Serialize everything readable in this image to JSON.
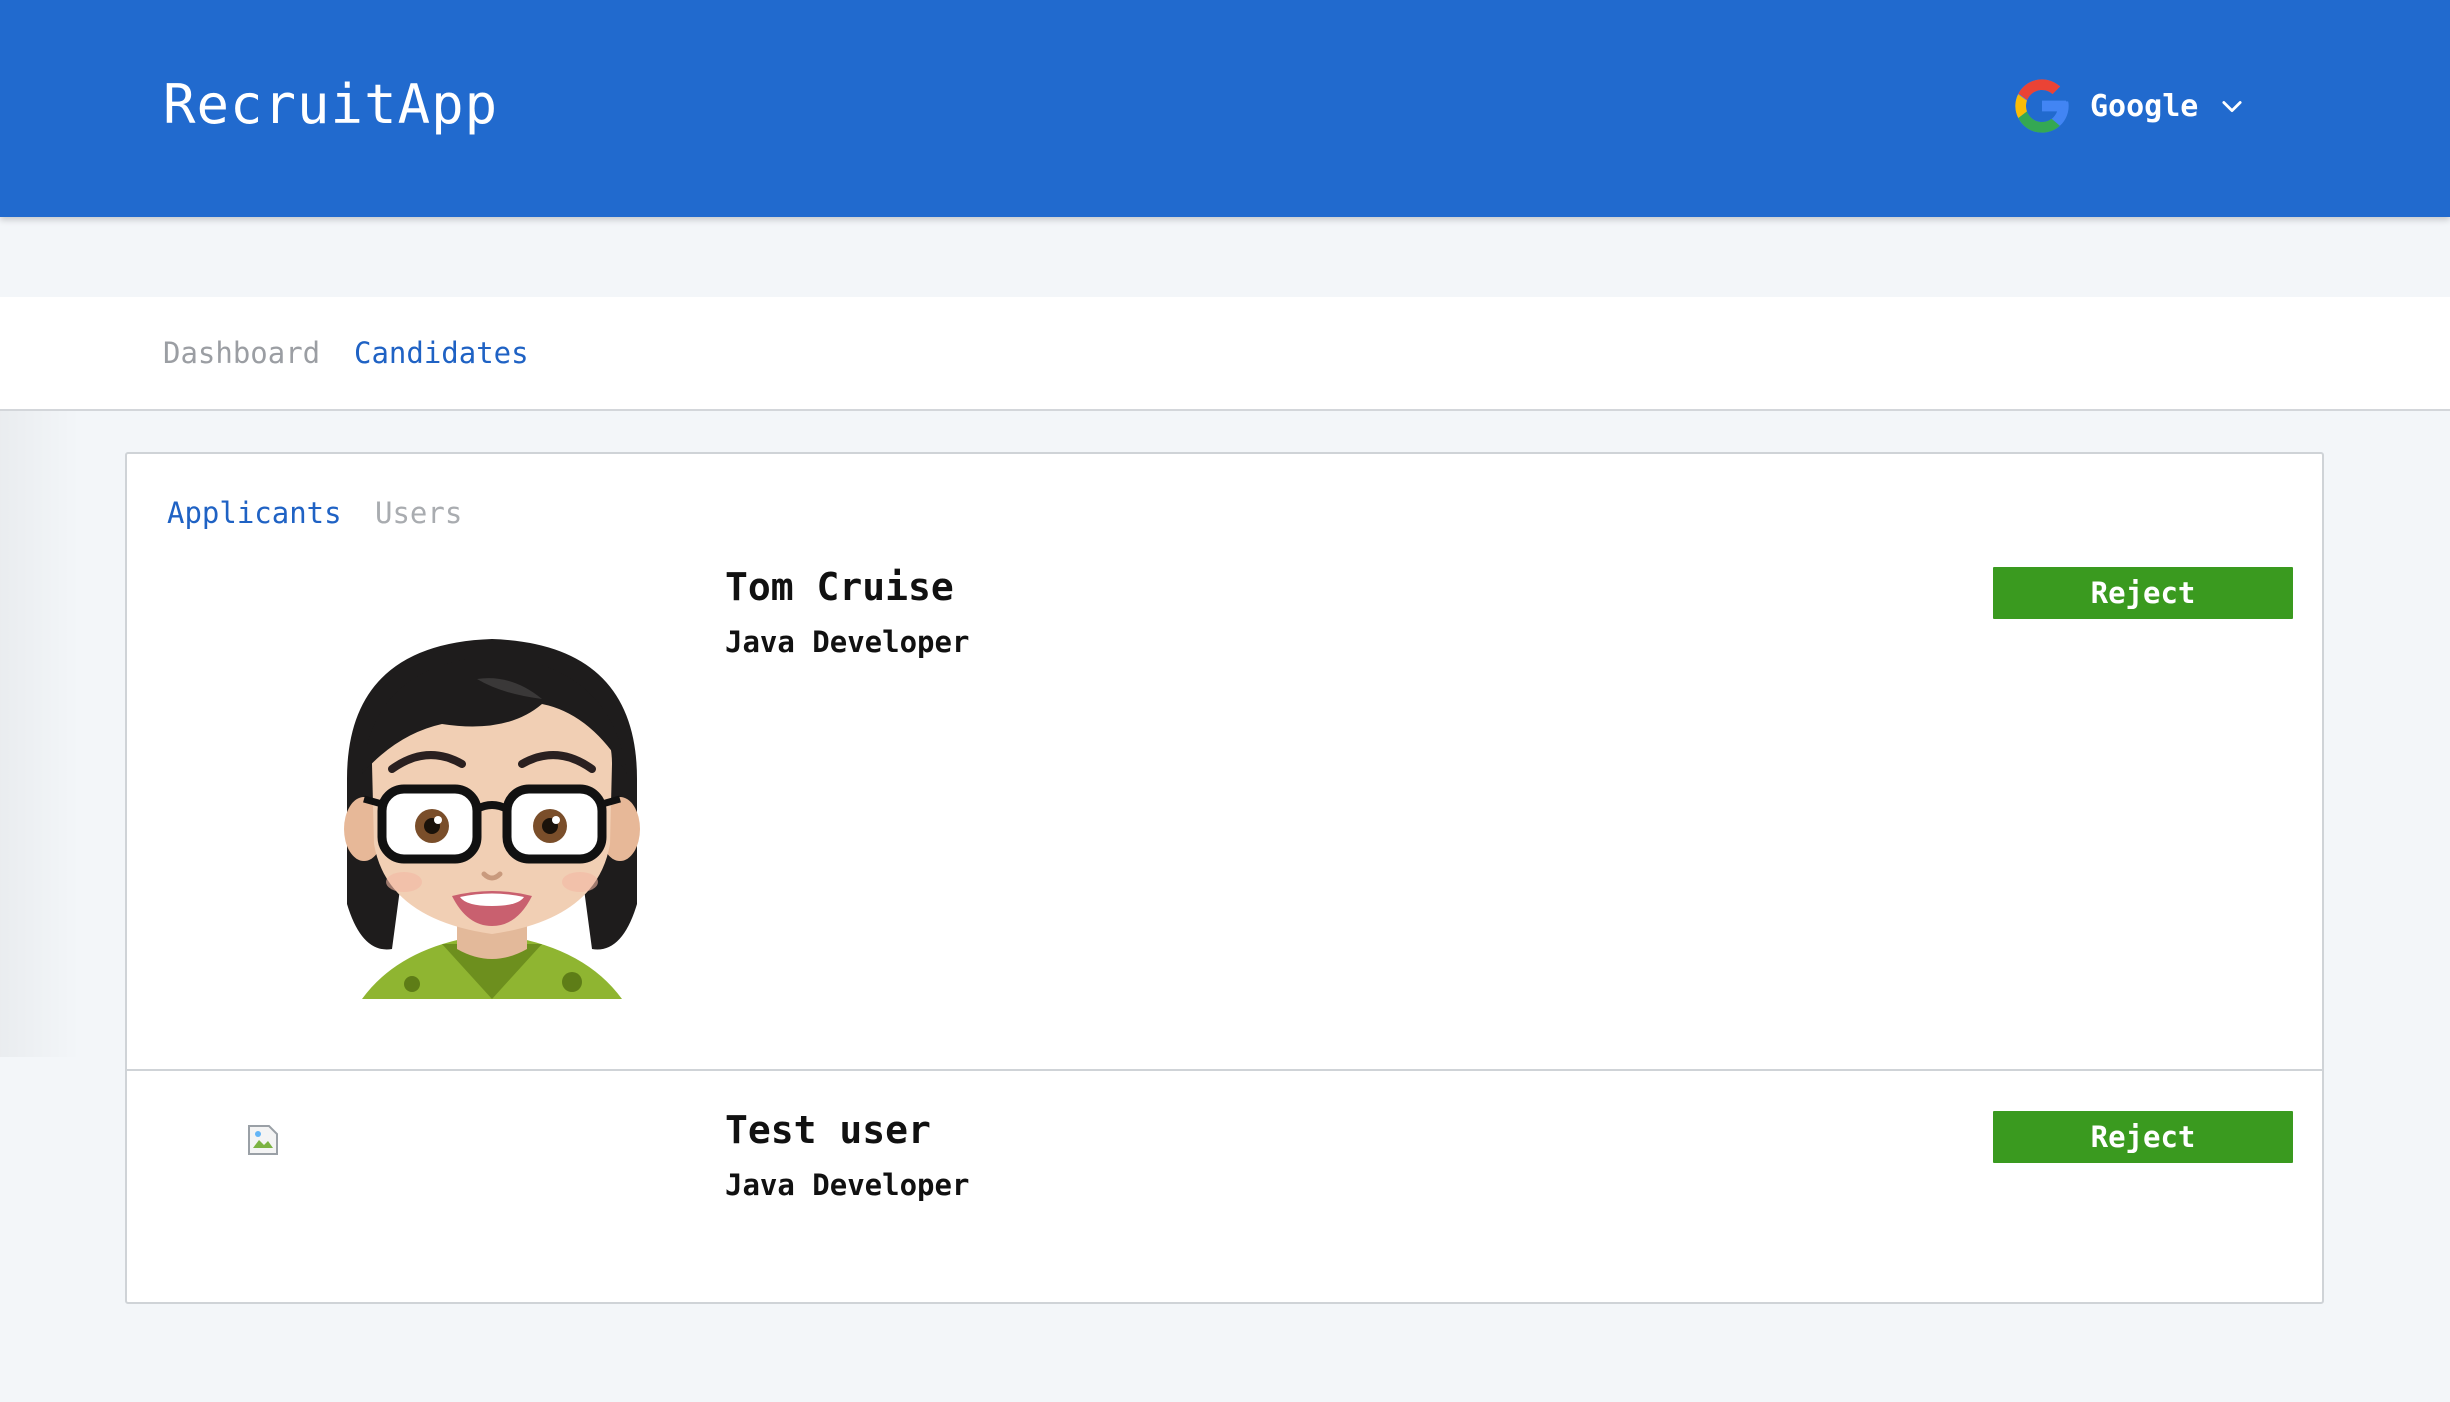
{
  "header": {
    "app_title": "RecruitApp",
    "account_label": "Google",
    "account_icon": "google-g-icon",
    "caret_icon": "chevron-down-icon",
    "background_color": "#216ace"
  },
  "nav": {
    "items": [
      {
        "label": "Dashboard",
        "active": false
      },
      {
        "label": "Candidates",
        "active": true
      }
    ]
  },
  "subtabs": {
    "items": [
      {
        "label": "Applicants",
        "active": true
      },
      {
        "label": "Users",
        "active": false
      }
    ]
  },
  "candidates": [
    {
      "name": "Tom Cruise",
      "role": "Java Developer",
      "action_label": "Reject",
      "avatar": "cartoon-avatar"
    },
    {
      "name": "Test user",
      "role": "Java Developer",
      "action_label": "Reject",
      "avatar": "broken-image"
    }
  ],
  "colors": {
    "accent": "#1f62c4",
    "reject": "#3a9a1f",
    "muted": "#9b9ea3"
  }
}
